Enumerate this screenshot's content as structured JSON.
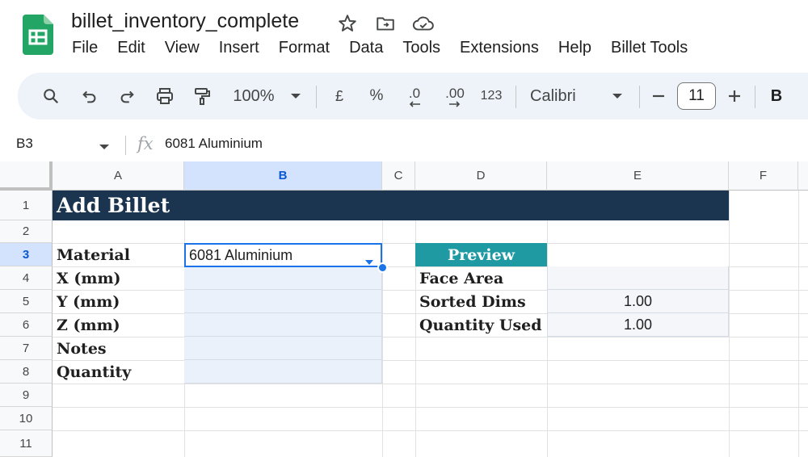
{
  "document": {
    "title": "billet_inventory_complete"
  },
  "menu": [
    "File",
    "Edit",
    "View",
    "Insert",
    "Format",
    "Data",
    "Tools",
    "Extensions",
    "Help",
    "Billet Tools"
  ],
  "toolbar": {
    "zoom": "100%",
    "currency": "£",
    "percent": "%",
    "decrease_decimals": ".0",
    "increase_decimals": ".00",
    "number_format": "123",
    "font": "Calibri",
    "font_size": "11",
    "bold": "B",
    "icons": [
      "search-icon",
      "undo-icon",
      "redo-icon",
      "print-icon",
      "paint-format-icon",
      "chevron-down-icon",
      "minus-icon",
      "plus-icon"
    ]
  },
  "formula_bar": {
    "cell_ref": "B3",
    "fx": "fx",
    "content": "6081 Aluminium"
  },
  "grid": {
    "columns": [
      "A",
      "B",
      "C",
      "D",
      "E",
      "F"
    ],
    "rows": [
      "1",
      "2",
      "3",
      "4",
      "5",
      "6",
      "7",
      "8",
      "9",
      "10",
      "11"
    ],
    "selected_column": "B",
    "selected_row": "3"
  },
  "sheet": {
    "banner": "Add Billet",
    "labels": [
      "Material",
      "X (mm)",
      "Y (mm)",
      "Z (mm)",
      "Notes",
      "Quantity"
    ],
    "material_value": "6081 Aluminium",
    "preview": {
      "header": "Preview",
      "labels": [
        "Face Area",
        "Sorted Dims",
        "Quantity Used"
      ],
      "values": [
        "",
        "1.00",
        "1.00"
      ]
    }
  },
  "colors": {
    "banner_bg": "#1b3450",
    "preview_bg": "#1f9aa3",
    "input_bg": "#eaf1fb",
    "selection": "#1a73e8",
    "logo_green": "#23a566"
  }
}
